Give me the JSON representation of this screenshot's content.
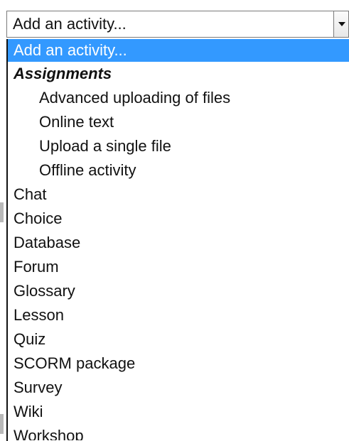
{
  "select": {
    "value": "Add an activity...",
    "icon": "chevron-down-icon"
  },
  "dropdown": {
    "options": [
      {
        "label": "Add an activity...",
        "state": "selected"
      },
      {
        "label": "Assignments",
        "state": "group"
      },
      {
        "label": "Advanced uploading of files",
        "state": "child"
      },
      {
        "label": "Online text",
        "state": "child"
      },
      {
        "label": "Upload a single file",
        "state": "child"
      },
      {
        "label": "Offline activity",
        "state": "child"
      },
      {
        "label": "Chat",
        "state": "normal"
      },
      {
        "label": "Choice",
        "state": "normal"
      },
      {
        "label": "Database",
        "state": "normal"
      },
      {
        "label": "Forum",
        "state": "normal"
      },
      {
        "label": "Glossary",
        "state": "normal"
      },
      {
        "label": "Lesson",
        "state": "normal"
      },
      {
        "label": "Quiz",
        "state": "normal"
      },
      {
        "label": "SCORM package",
        "state": "normal"
      },
      {
        "label": "Survey",
        "state": "normal"
      },
      {
        "label": "Wiki",
        "state": "normal"
      },
      {
        "label": "Workshop",
        "state": "cut"
      }
    ]
  }
}
